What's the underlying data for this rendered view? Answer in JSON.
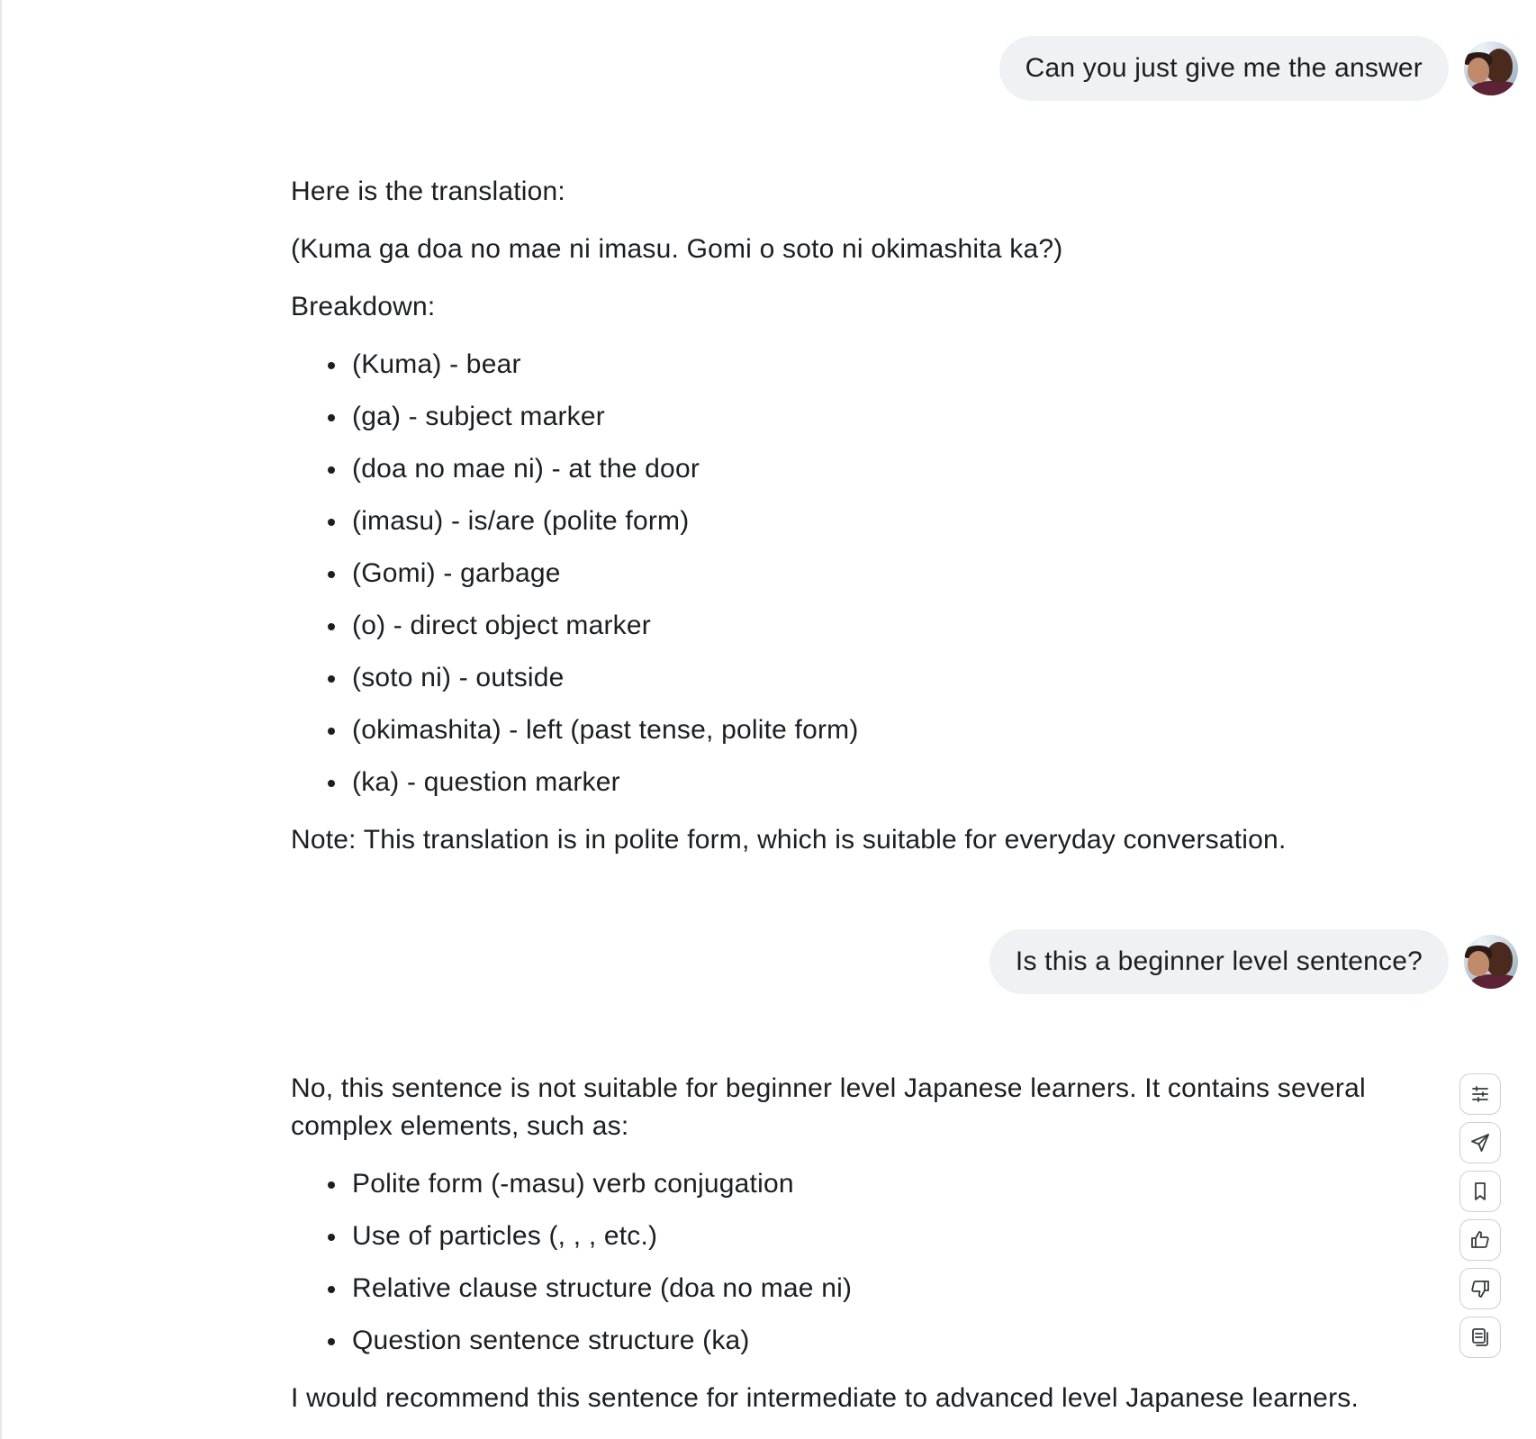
{
  "conversation": {
    "user_message_1": "Can you just give me the answer",
    "assistant_1": {
      "intro": "Here is the translation:",
      "translation": "(Kuma ga doa no mae ni imasu. Gomi o soto ni okimashita ka?)",
      "breakdown_heading": "Breakdown:",
      "items": [
        "(Kuma) - bear",
        "(ga) - subject marker",
        "(doa no mae ni) - at the door",
        "(imasu) - is/are (polite form)",
        "(Gomi) - garbage",
        "(o) - direct object marker",
        "(soto ni) - outside",
        "(okimashita) - left (past tense, polite form)",
        "(ka) - question marker"
      ],
      "note": "Note: This translation is in polite form, which is suitable for everyday conversation."
    },
    "user_message_2": "Is this a beginner level sentence?",
    "assistant_2": {
      "intro": "No, this sentence is not suitable for beginner level Japanese learners. It contains several complex elements, such as:",
      "items": [
        "Polite form (-masu) verb conjugation",
        "Use of particles (, , , etc.)",
        "Relative clause structure (doa no mae ni)",
        "Question sentence structure (ka)"
      ],
      "conclusion": "I would recommend this sentence for intermediate to advanced level Japanese learners."
    }
  },
  "actions": [
    {
      "icon": "sliders-icon"
    },
    {
      "icon": "send-icon"
    },
    {
      "icon": "bookmark-icon"
    },
    {
      "icon": "thumbs-up-icon"
    },
    {
      "icon": "thumbs-down-icon"
    },
    {
      "icon": "copy-icon"
    }
  ],
  "colors": {
    "user_bubble": "#eff2f5",
    "text": "#1c1e21",
    "button_border": "#ccd0d5"
  }
}
